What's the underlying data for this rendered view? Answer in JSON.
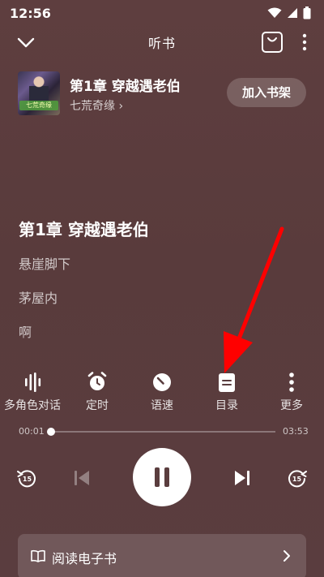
{
  "status_bar": {
    "time": "12:56"
  },
  "header": {
    "title": "听书"
  },
  "book": {
    "title": "第1章 穿越遇老伯",
    "author": "七荒奇缘 ›",
    "cover_text": "七荒奇缘",
    "add_to_shelf": "加入书架"
  },
  "content": {
    "heading": "第1章 穿越遇老伯",
    "lines": [
      "悬崖脚下",
      "茅屋内",
      "啊"
    ]
  },
  "controls": [
    {
      "label": "多角色对话",
      "icon": "voice-wave-icon"
    },
    {
      "label": "定时",
      "icon": "alarm-clock-icon"
    },
    {
      "label": "语速",
      "icon": "speed-gauge-icon"
    },
    {
      "label": "目录",
      "icon": "catalog-list-icon"
    },
    {
      "label": "更多",
      "icon": "more-vertical-icon"
    }
  ],
  "progress": {
    "current": "00:01",
    "total": "03:53",
    "fraction": 0.005
  },
  "player": {
    "rewind_label": "15",
    "forward_label": "15"
  },
  "read_bar": {
    "label": "阅读电子书"
  },
  "colors": {
    "background": "#5a3d3e",
    "annotation_arrow": "#ff0000"
  }
}
